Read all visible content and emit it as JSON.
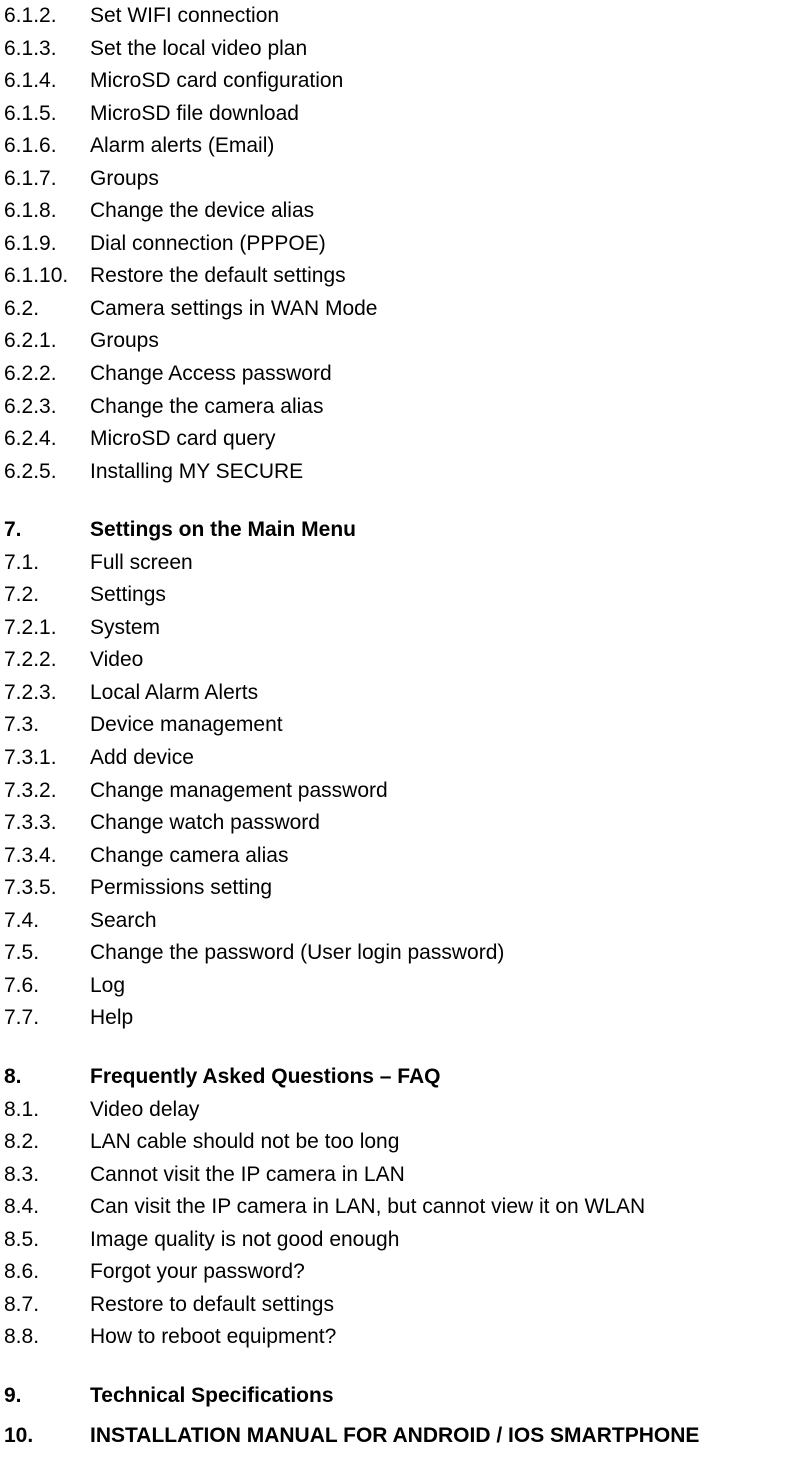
{
  "entries": [
    {
      "num": "6.1.2.",
      "title": "Set WIFI connection",
      "bold": false,
      "before": ""
    },
    {
      "num": "6.1.3.",
      "title": "Set the local video plan",
      "bold": false,
      "before": ""
    },
    {
      "num": "6.1.4.",
      "title": "MicroSD card configuration",
      "bold": false,
      "before": ""
    },
    {
      "num": "6.1.5.",
      "title": "MicroSD file download",
      "bold": false,
      "before": ""
    },
    {
      "num": "6.1.6.",
      "title": "Alarm alerts (Email)",
      "bold": false,
      "before": ""
    },
    {
      "num": "6.1.7.",
      "title": "Groups",
      "bold": false,
      "before": ""
    },
    {
      "num": "6.1.8.",
      "title": "Change the device alias",
      "bold": false,
      "before": ""
    },
    {
      "num": "6.1.9.",
      "title": "Dial connection (PPPOE)",
      "bold": false,
      "before": ""
    },
    {
      "num": "6.1.10.",
      "title": "Restore the default settings",
      "bold": false,
      "before": ""
    },
    {
      "num": "6.2.",
      "title": "Camera settings in WAN Mode",
      "bold": false,
      "before": ""
    },
    {
      "num": "6.2.1.",
      "title": "Groups",
      "bold": false,
      "before": ""
    },
    {
      "num": "6.2.2.",
      "title": "Change Access password",
      "bold": false,
      "before": ""
    },
    {
      "num": "6.2.3.",
      "title": "Change the camera alias",
      "bold": false,
      "before": ""
    },
    {
      "num": "6.2.4.",
      "title": "MicroSD card query",
      "bold": false,
      "before": ""
    },
    {
      "num": "6.2.5.",
      "title": "Installing MY SECURE",
      "bold": false,
      "before": ""
    },
    {
      "num": "7.",
      "title": "Settings on the Main Menu",
      "bold": true,
      "before": "gap"
    },
    {
      "num": "7.1.",
      "title": "Full screen",
      "bold": false,
      "before": ""
    },
    {
      "num": "7.2.",
      "title": "Settings",
      "bold": false,
      "before": ""
    },
    {
      "num": "7.2.1.",
      "title": "System",
      "bold": false,
      "before": ""
    },
    {
      "num": "7.2.2.",
      "title": "Video",
      "bold": false,
      "before": ""
    },
    {
      "num": "7.2.3.",
      "title": "Local Alarm Alerts",
      "bold": false,
      "before": ""
    },
    {
      "num": "7.3.",
      "title": "Device management",
      "bold": false,
      "before": ""
    },
    {
      "num": "7.3.1.",
      "title": "Add device",
      "bold": false,
      "before": ""
    },
    {
      "num": "7.3.2.",
      "title": "Change management password",
      "bold": false,
      "before": ""
    },
    {
      "num": "7.3.3.",
      "title": "Change watch password",
      "bold": false,
      "before": ""
    },
    {
      "num": "7.3.4.",
      "title": "Change camera alias",
      "bold": false,
      "before": ""
    },
    {
      "num": "7.3.5.",
      "title": "Permissions setting",
      "bold": false,
      "before": ""
    },
    {
      "num": "7.4.",
      "title": "Search",
      "bold": false,
      "before": ""
    },
    {
      "num": "7.5.",
      "title": "Change the password (User login password)",
      "bold": false,
      "before": ""
    },
    {
      "num": "7.6.",
      "title": "Log",
      "bold": false,
      "before": ""
    },
    {
      "num": "7.7.",
      "title": "Help",
      "bold": false,
      "before": ""
    },
    {
      "num": "8.",
      "title": "Frequently Asked Questions – FAQ",
      "bold": true,
      "before": "gap"
    },
    {
      "num": "8.1.",
      "title": "Video delay",
      "bold": false,
      "before": ""
    },
    {
      "num": "8.2.",
      "title": "LAN cable should not be too long",
      "bold": false,
      "before": ""
    },
    {
      "num": "8.3.",
      "title": "Cannot visit the IP camera in LAN",
      "bold": false,
      "before": ""
    },
    {
      "num": "8.4.",
      "title": "Can visit the IP camera in LAN, but cannot view it on WLAN",
      "bold": false,
      "before": ""
    },
    {
      "num": "8.5.",
      "title": "Image quality is not good enough",
      "bold": false,
      "before": ""
    },
    {
      "num": "8.6.",
      "title": "Forgot your password?",
      "bold": false,
      "before": ""
    },
    {
      "num": "8.7.",
      "title": "Restore to default settings",
      "bold": false,
      "before": ""
    },
    {
      "num": "8.8.",
      "title": "How to reboot equipment?",
      "bold": false,
      "before": ""
    },
    {
      "num": "9.",
      "title": "Technical Specifications",
      "bold": true,
      "before": "gap"
    },
    {
      "num": "10.",
      "title": "INSTALLATION MANUAL FOR ANDROID / IOS SMARTPHONE",
      "bold": true,
      "before": "small-gap"
    }
  ]
}
